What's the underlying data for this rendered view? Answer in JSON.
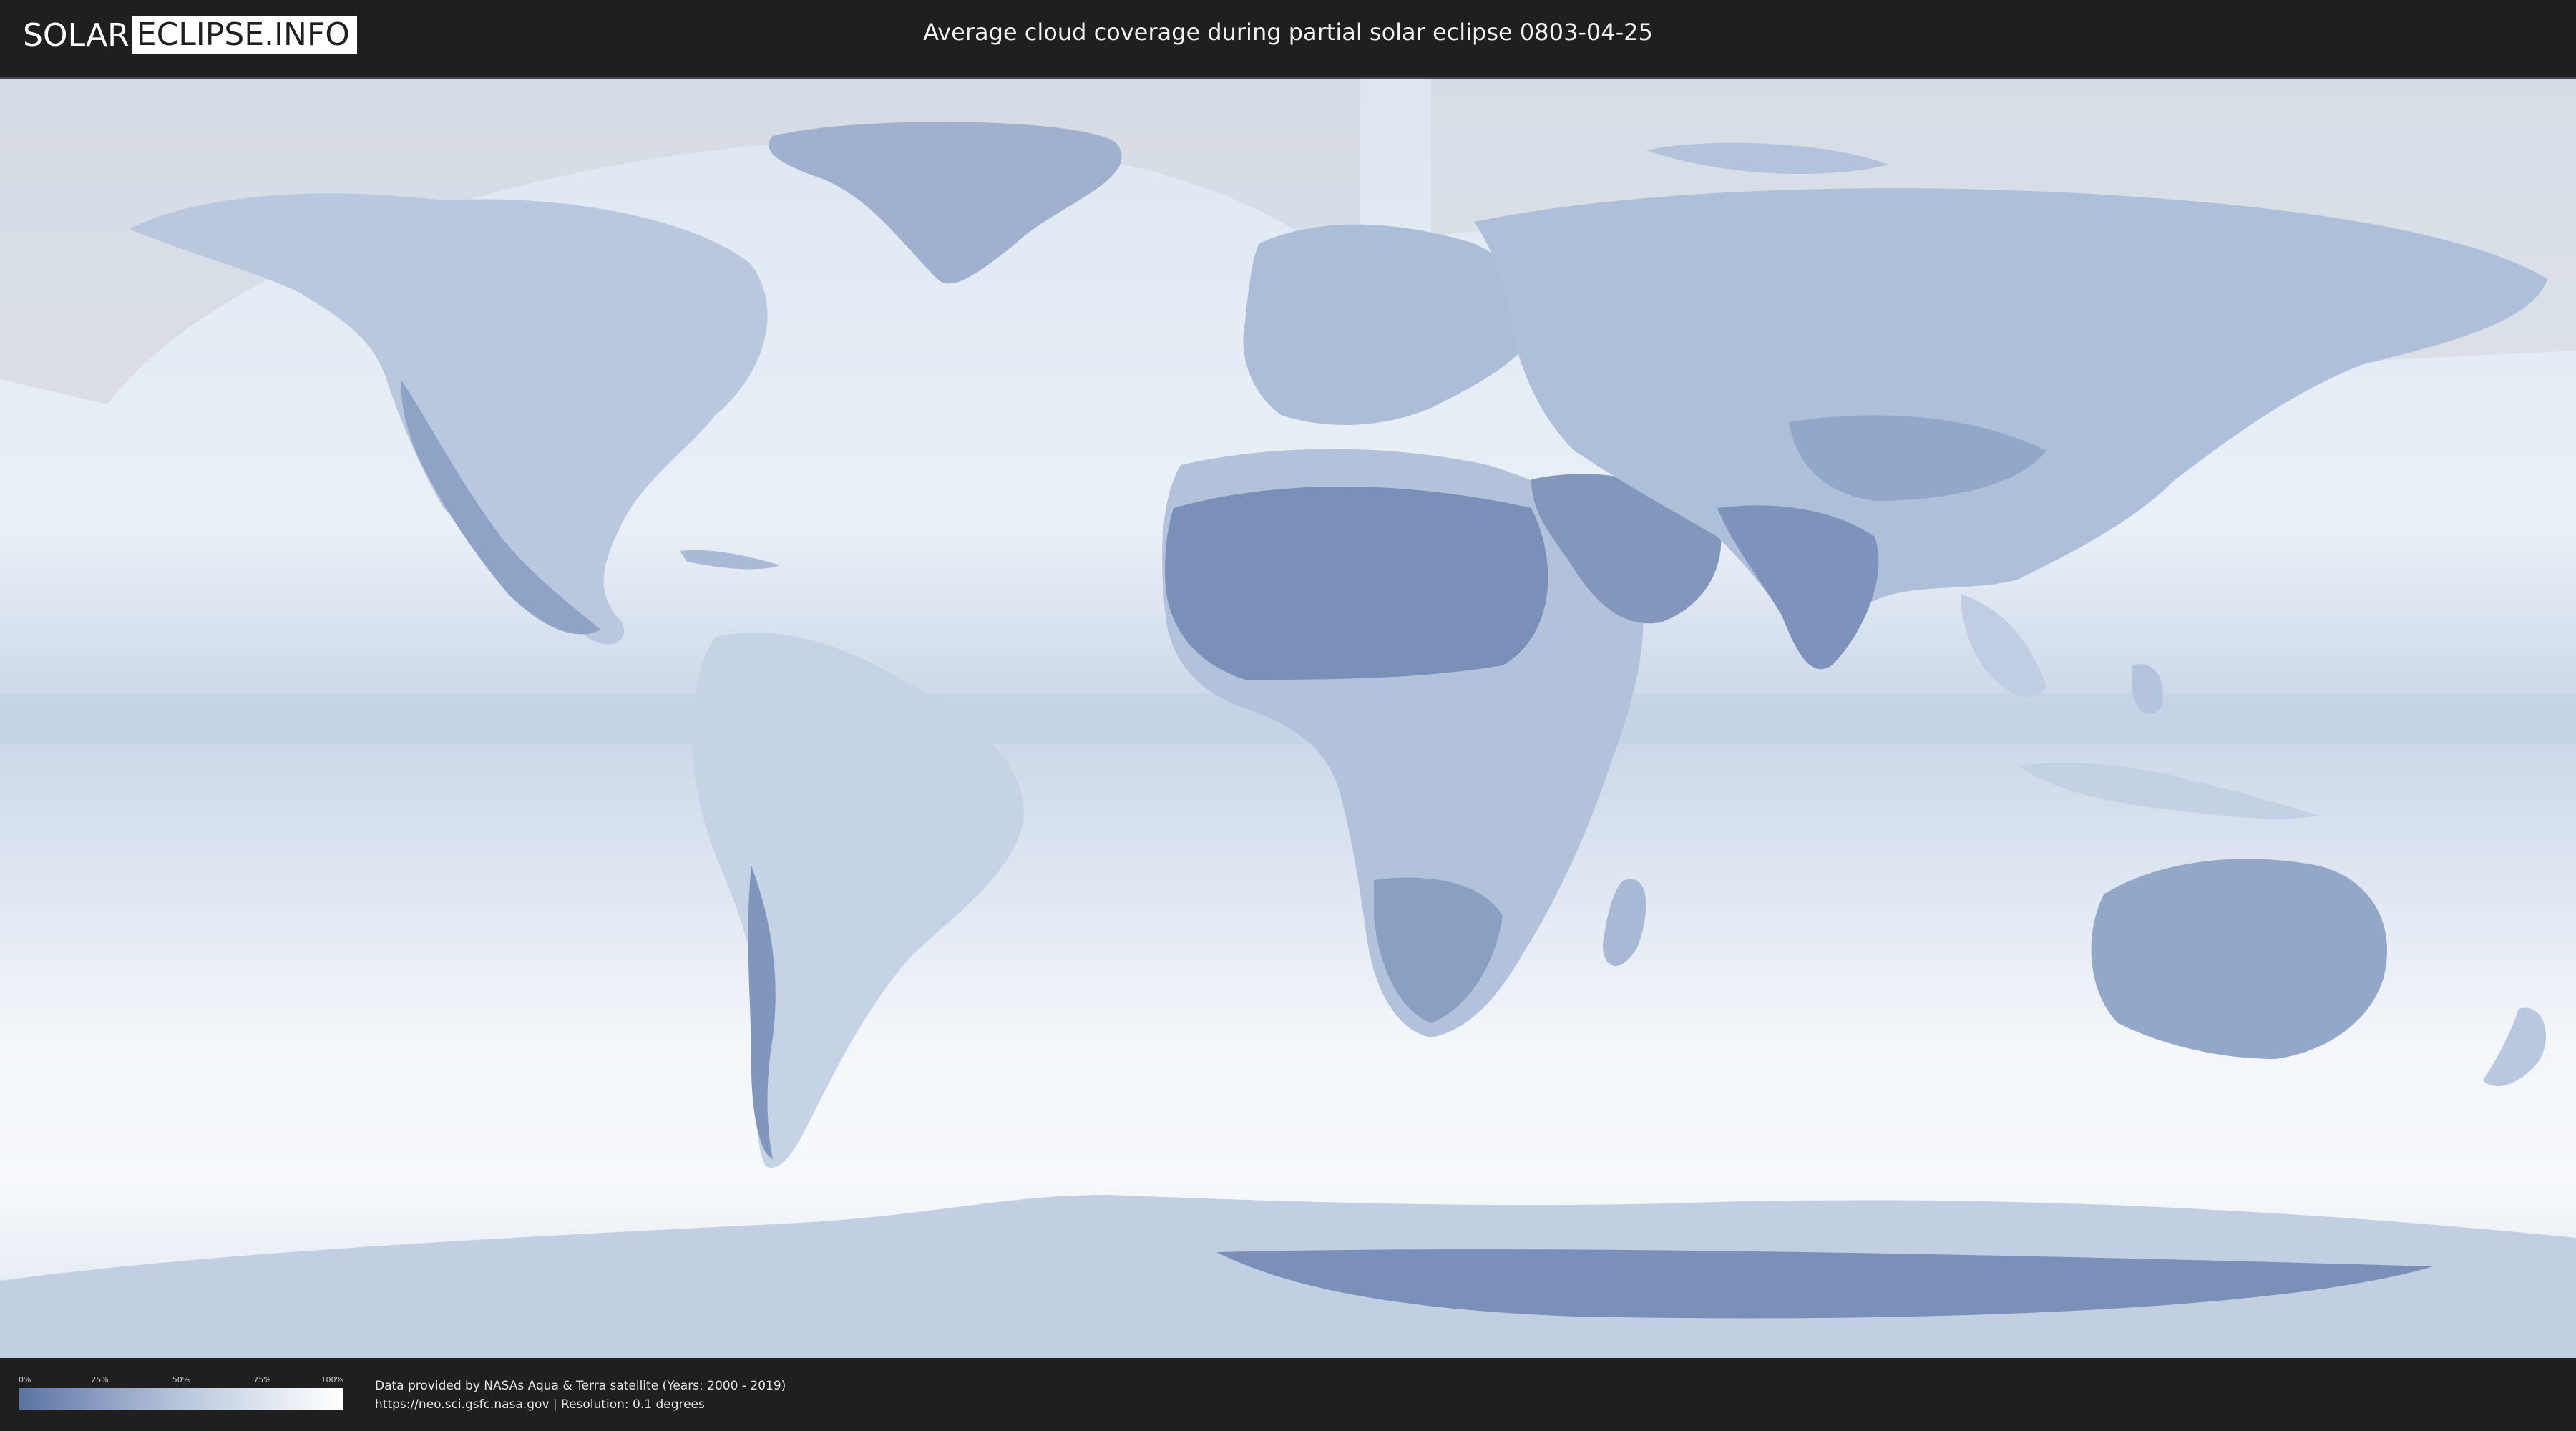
{
  "header": {
    "logo_left": "SOLAR",
    "logo_right": "ECLIPSE.INFO",
    "title": "Average cloud coverage during partial solar eclipse 0803-04-25"
  },
  "legend": {
    "ticks": [
      "0%",
      "25%",
      "50%",
      "75%",
      "100%"
    ],
    "colors": {
      "low": "#5b72a3",
      "high": "#ffffff"
    }
  },
  "credit": {
    "line1": "Data provided by NASAs Aqua & Terra satellite (Years: 2000 - 2019)",
    "line2": "https://neo.sci.gsfc.nasa.gov | Resolution: 0.1 degrees"
  },
  "colors": {
    "background": "#1f1f1f",
    "ocean_clouds": "#e8eef6",
    "land_low_cloud": "#6f86b4"
  }
}
